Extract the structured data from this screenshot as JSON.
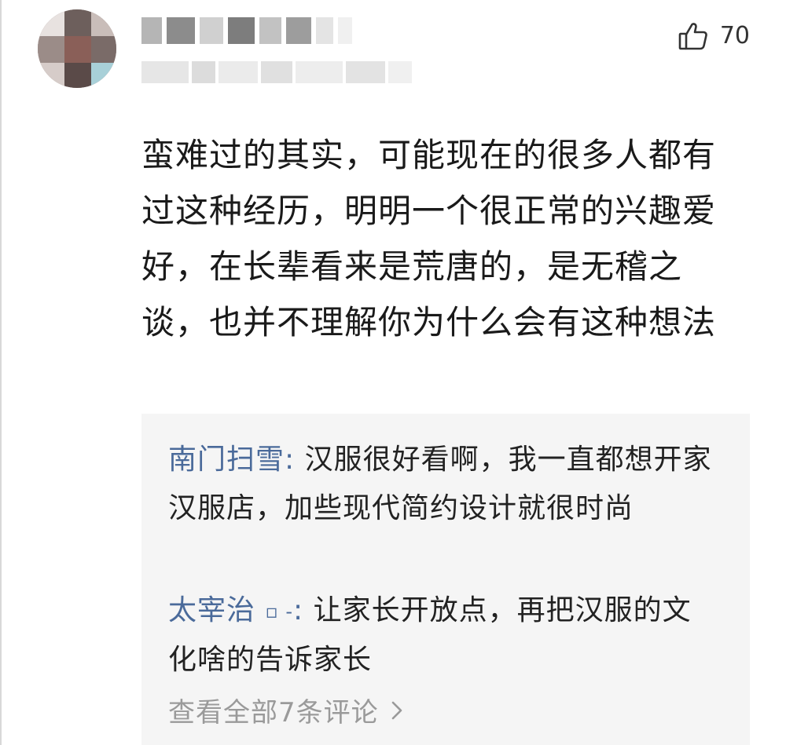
{
  "comment": {
    "likes": "70",
    "text": "蛮难过的其实，可能现在的很多人都有过这种经历，明明一个很正常的兴趣爱好，在长辈看来是荒唐的，是无稽之谈，也并不理解你为什么会有这种想法"
  },
  "replies": [
    {
      "author": "南门扫雪",
      "separator": ":",
      "text": "汉服很好看啊，我一直都想开家汉服店，加些现代简约设计就很时尚"
    },
    {
      "author": "太宰治",
      "author_suffix": "▫ -",
      "separator": ":",
      "text": "让家长开放点，再把汉服的文化啥的告诉家长"
    }
  ],
  "view_all_label": "查看全部7条评论",
  "icons": {
    "like": "thumbs-up-icon",
    "chevron": "chevron-right-icon"
  },
  "colors": {
    "author_link": "#4a6a9a",
    "reply_bg": "#f5f5f5",
    "muted": "#9a9a9a"
  }
}
